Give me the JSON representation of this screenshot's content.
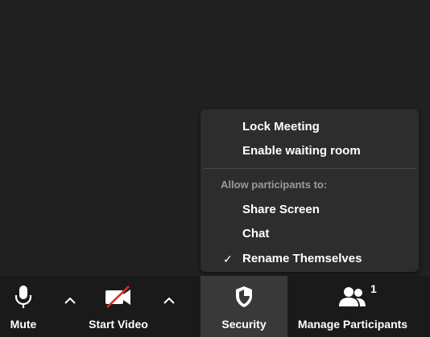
{
  "menu": {
    "lock_meeting": "Lock Meeting",
    "enable_waiting_room": "Enable waiting room",
    "section_heading": "Allow participants to:",
    "share_screen": "Share Screen",
    "chat": "Chat",
    "rename_themselves": "Rename Themselves",
    "rename_checked": true,
    "check_glyph": "✓"
  },
  "toolbar": {
    "mute_label": "Mute",
    "start_video_label": "Start Video",
    "security_label": "Security",
    "manage_participants_label": "Manage Participants",
    "participant_count": "1"
  },
  "colors": {
    "background": "#212121",
    "toolbar": "#1a1a1a",
    "menu": "#2d2d2d",
    "video_off": "#e02828"
  },
  "icons": {
    "mute": "microphone-icon",
    "video": "video-camera-off-icon",
    "security": "shield-icon",
    "participants": "people-icon",
    "caret": "chevron-up-icon"
  }
}
